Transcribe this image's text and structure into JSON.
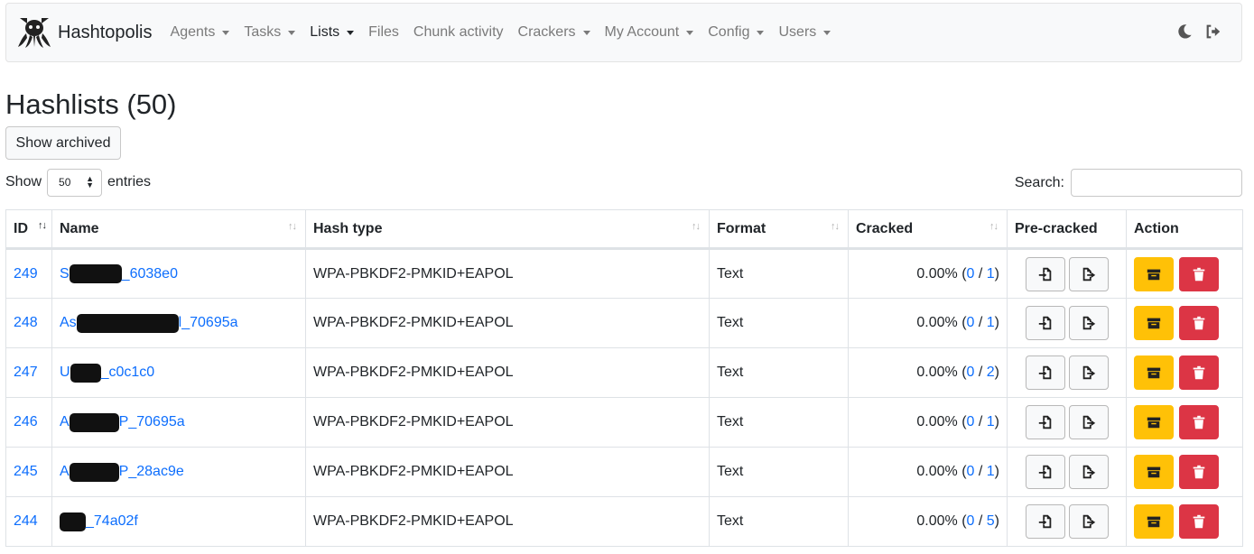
{
  "brand": {
    "name": "Hashtopolis"
  },
  "nav": [
    {
      "label": "Agents",
      "dropdown": true,
      "active": false
    },
    {
      "label": "Tasks",
      "dropdown": true,
      "active": false
    },
    {
      "label": "Lists",
      "dropdown": true,
      "active": true
    },
    {
      "label": "Files",
      "dropdown": false,
      "active": false
    },
    {
      "label": "Chunk activity",
      "dropdown": false,
      "active": false
    },
    {
      "label": "Crackers",
      "dropdown": true,
      "active": false
    },
    {
      "label": "My Account",
      "dropdown": true,
      "active": false
    },
    {
      "label": "Config",
      "dropdown": true,
      "active": false
    },
    {
      "label": "Users",
      "dropdown": true,
      "active": false
    }
  ],
  "page": {
    "title": "Hashlists (50)",
    "show_archived": "Show archived",
    "show_label": "Show",
    "entries_value": "50",
    "entries_label": "entries",
    "search_label": "Search:",
    "search_value": ""
  },
  "table": {
    "columns": [
      "ID",
      "Name",
      "Hash type",
      "Format",
      "Cracked",
      "Pre-cracked",
      "Action"
    ],
    "rows": [
      {
        "id": "249",
        "name_prefix": "S",
        "name_suffix": "_6038e0",
        "hash_type": "WPA-PBKDF2-PMKID+EAPOL",
        "format": "Text",
        "percent": "0.00% (",
        "cracked": "0",
        "sep": " / ",
        "total": "1",
        "close": ")"
      },
      {
        "id": "248",
        "name_prefix": "As",
        "name_suffix": "l_70695a",
        "hash_type": "WPA-PBKDF2-PMKID+EAPOL",
        "format": "Text",
        "percent": "0.00% (",
        "cracked": "0",
        "sep": " / ",
        "total": "1",
        "close": ")"
      },
      {
        "id": "247",
        "name_prefix": "U",
        "name_suffix": "_c0c1c0",
        "hash_type": "WPA-PBKDF2-PMKID+EAPOL",
        "format": "Text",
        "percent": "0.00% (",
        "cracked": "0",
        "sep": " / ",
        "total": "2",
        "close": ")"
      },
      {
        "id": "246",
        "name_prefix": "A",
        "name_suffix": "P_70695a",
        "hash_type": "WPA-PBKDF2-PMKID+EAPOL",
        "format": "Text",
        "percent": "0.00% (",
        "cracked": "0",
        "sep": " / ",
        "total": "1",
        "close": ")"
      },
      {
        "id": "245",
        "name_prefix": "A",
        "name_suffix": "P_28ac9e",
        "hash_type": "WPA-PBKDF2-PMKID+EAPOL",
        "format": "Text",
        "percent": "0.00% (",
        "cracked": "0",
        "sep": " / ",
        "total": "1",
        "close": ")"
      },
      {
        "id": "244",
        "name_prefix": "",
        "name_suffix": "_74a02f",
        "hash_type": "WPA-PBKDF2-PMKID+EAPOL",
        "format": "Text",
        "percent": "0.00% (",
        "cracked": "0",
        "sep": " / ",
        "total": "5",
        "close": ")"
      }
    ]
  },
  "colors": {
    "link": "#0d6efd",
    "warning": "#ffc107",
    "danger": "#dc3545",
    "navbar_bg": "#f8f9fa"
  },
  "icons": {
    "brand": "hashtopolis-logo",
    "theme": "moon-icon",
    "logout": "logout-icon",
    "import": "file-import-icon",
    "export": "file-export-icon",
    "archive": "archive-box-icon",
    "delete": "trash-icon"
  }
}
